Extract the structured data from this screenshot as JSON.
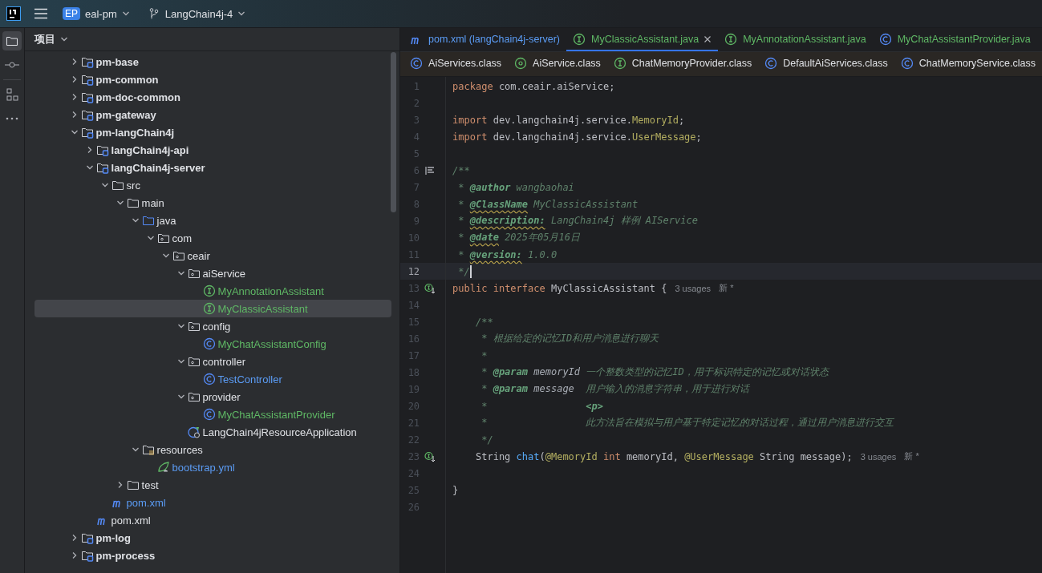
{
  "toolbar": {
    "project": {
      "badge": "EP",
      "name": "eal-pm"
    },
    "branch": "LangChain4j-4"
  },
  "project_panel": {
    "title": "项目",
    "tree": [
      {
        "name": "pm-base",
        "kind": "module",
        "color": "#dfe1e5",
        "expanded": false,
        "selected": false
      },
      {
        "name": "pm-common",
        "kind": "module",
        "color": "#dfe1e5",
        "expanded": false,
        "selected": false
      },
      {
        "name": "pm-doc-common",
        "kind": "module",
        "color": "#dfe1e5",
        "expanded": false,
        "selected": false
      },
      {
        "name": "pm-gateway",
        "kind": "module",
        "color": "#dfe1e5",
        "expanded": false,
        "selected": false
      },
      {
        "name": "pm-langChain4j",
        "kind": "module",
        "color": "#dfe1e5",
        "expanded": true,
        "selected": false,
        "children": [
          {
            "name": "langChain4j-api",
            "kind": "module",
            "color": "#dfe1e5",
            "expanded": false,
            "selected": false
          },
          {
            "name": "langChain4j-server",
            "kind": "module",
            "color": "#dfe1e5",
            "expanded": true,
            "selected": false,
            "children": [
              {
                "name": "src",
                "kind": "folder",
                "color": "#dfe1e5",
                "expanded": true,
                "selected": false,
                "children": [
                  {
                    "name": "main",
                    "kind": "folder",
                    "color": "#dfe1e5",
                    "expanded": true,
                    "selected": false,
                    "children": [
                      {
                        "name": "java",
                        "kind": "source-folder",
                        "color": "#dfe1e5",
                        "expanded": true,
                        "selected": false,
                        "children": [
                          {
                            "name": "com",
                            "kind": "package",
                            "color": "#dfe1e5",
                            "expanded": true,
                            "selected": false,
                            "children": [
                              {
                                "name": "ceair",
                                "kind": "package",
                                "color": "#dfe1e5",
                                "expanded": true,
                                "selected": false,
                                "children": [
                                  {
                                    "name": "aiService",
                                    "kind": "package",
                                    "color": "#dfe1e5",
                                    "expanded": true,
                                    "selected": false,
                                    "children": [
                                      {
                                        "name": "MyAnnotationAssistant",
                                        "kind": "interface",
                                        "color": "#5fb865",
                                        "selected": false
                                      },
                                      {
                                        "name": "MyClassicAssistant",
                                        "kind": "interface",
                                        "color": "#5fb865",
                                        "selected": true
                                      }
                                    ]
                                  },
                                  {
                                    "name": "config",
                                    "kind": "package",
                                    "color": "#dfe1e5",
                                    "expanded": true,
                                    "selected": false,
                                    "children": [
                                      {
                                        "name": "MyChatAssistantConfig",
                                        "kind": "class",
                                        "color": "#5fb865",
                                        "selected": false
                                      }
                                    ]
                                  },
                                  {
                                    "name": "controller",
                                    "kind": "package",
                                    "color": "#dfe1e5",
                                    "expanded": true,
                                    "selected": false,
                                    "children": [
                                      {
                                        "name": "TestController",
                                        "kind": "class",
                                        "color": "#5b9cf5",
                                        "selected": false
                                      }
                                    ]
                                  },
                                  {
                                    "name": "provider",
                                    "kind": "package",
                                    "color": "#dfe1e5",
                                    "expanded": true,
                                    "selected": false,
                                    "children": [
                                      {
                                        "name": "MyChatAssistantProvider",
                                        "kind": "class",
                                        "color": "#5fb865",
                                        "selected": false
                                      }
                                    ]
                                  },
                                  {
                                    "name": "LangChain4jResourceApplication",
                                    "kind": "app",
                                    "color": "#dfe1e5",
                                    "selected": false
                                  }
                                ]
                              }
                            ]
                          }
                        ]
                      },
                      {
                        "name": "resources",
                        "kind": "resource-folder",
                        "color": "#dfe1e5",
                        "expanded": true,
                        "selected": false,
                        "children": [
                          {
                            "name": "bootstrap.yml",
                            "kind": "yml",
                            "color": "#5b9cf5",
                            "selected": false
                          }
                        ]
                      }
                    ]
                  },
                  {
                    "name": "test",
                    "kind": "folder",
                    "color": "#dfe1e5",
                    "expanded": false,
                    "selected": false
                  }
                ]
              },
              {
                "name": "pom.xml",
                "kind": "maven",
                "color": "#5b9cf5",
                "selected": false
              }
            ]
          },
          {
            "name": "pom.xml",
            "kind": "maven",
            "color": "#dfe1e5",
            "selected": false
          }
        ]
      },
      {
        "name": "pm-log",
        "kind": "module",
        "color": "#dfe1e5",
        "expanded": false,
        "selected": false
      },
      {
        "name": "pm-process",
        "kind": "module",
        "color": "#dfe1e5",
        "expanded": false,
        "selected": false
      }
    ]
  },
  "editor_tabs": [
    {
      "label": "pom.xml (langChain4j-server)",
      "kind": "maven",
      "color": "#5b9cf5",
      "selected": false
    },
    {
      "label": "MyClassicAssistant.java",
      "kind": "interface",
      "color": "#5fb865",
      "selected": true
    },
    {
      "label": "MyAnnotationAssistant.java",
      "kind": "interface",
      "color": "#5fb865",
      "selected": false
    },
    {
      "label": "MyChatAssistantProvider.java",
      "kind": "class",
      "color": "#5fb865",
      "selected": false
    }
  ],
  "editor_tabs_row2": [
    {
      "label": "AiServices.class",
      "kind": "class",
      "selected": false
    },
    {
      "label": "AiService.class",
      "kind": "annotation",
      "selected": false
    },
    {
      "label": "ChatMemoryProvider.class",
      "kind": "interface",
      "selected": false
    },
    {
      "label": "DefaultAiServices.class",
      "kind": "class",
      "selected": false
    },
    {
      "label": "ChatMemoryService.class",
      "kind": "class",
      "selected": false
    }
  ],
  "code_lines": [
    {
      "number": "1",
      "current": false,
      "tokens": [
        {
          "kind": "keyword",
          "text": "package"
        },
        {
          "kind": "plain",
          "text": " com.ceair.aiService;"
        }
      ]
    },
    {
      "number": "2",
      "current": false
    },
    {
      "number": "3",
      "current": false,
      "tokens": [
        {
          "kind": "keyword",
          "text": "import"
        },
        {
          "kind": "plain",
          "text": " dev.langchain4j.service."
        },
        {
          "kind": "annotation",
          "text": "MemoryId"
        },
        {
          "kind": "plain",
          "text": ";"
        }
      ]
    },
    {
      "number": "4",
      "current": false,
      "tokens": [
        {
          "kind": "keyword",
          "text": "import"
        },
        {
          "kind": "plain",
          "text": " dev.langchain4j.service."
        },
        {
          "kind": "annotation",
          "text": "UserMessage"
        },
        {
          "kind": "plain",
          "text": ";"
        }
      ]
    },
    {
      "number": "5",
      "current": false
    },
    {
      "number": "6",
      "current": false,
      "doc_marker": true,
      "tokens": [
        {
          "kind": "comment",
          "text": "/**"
        }
      ]
    },
    {
      "number": "7",
      "current": false,
      "tokens": [
        {
          "kind": "comment",
          "text": " * "
        },
        {
          "kind": "doctag",
          "text": "@author"
        },
        {
          "kind": "comment",
          "text": " wangbaohai"
        }
      ]
    },
    {
      "number": "8",
      "current": false,
      "tokens": [
        {
          "kind": "comment",
          "text": " * "
        },
        {
          "kind": "doctag",
          "text": "@ClassName",
          "warning": true
        },
        {
          "kind": "comment",
          "text": " MyClassicAssistant"
        }
      ]
    },
    {
      "number": "9",
      "current": false,
      "tokens": [
        {
          "kind": "comment",
          "text": " * "
        },
        {
          "kind": "doctag",
          "text": "@description:",
          "warning": true
        },
        {
          "kind": "comment",
          "text": " LangChain4j 样例 AIService"
        }
      ]
    },
    {
      "number": "10",
      "current": false,
      "tokens": [
        {
          "kind": "comment",
          "text": " * "
        },
        {
          "kind": "doctag",
          "text": "@date",
          "warning": true
        },
        {
          "kind": "comment",
          "text": " 2025年05月16日"
        }
      ]
    },
    {
      "number": "11",
      "current": false,
      "tokens": [
        {
          "kind": "comment",
          "text": " * "
        },
        {
          "kind": "doctag",
          "text": "@version:",
          "warning": true
        },
        {
          "kind": "comment",
          "text": " 1.0.0"
        }
      ]
    },
    {
      "number": "12",
      "current": true,
      "tokens": [
        {
          "kind": "comment",
          "text": " */"
        }
      ]
    },
    {
      "number": "13",
      "current": false,
      "implemented_marker": true,
      "tokens": [
        {
          "kind": "keyword",
          "text": "public"
        },
        {
          "kind": "keyword",
          "text": " interface"
        },
        {
          "kind": "plain",
          "text": " MyClassicAssistant {"
        }
      ],
      "hints": [
        "3 usages",
        "新 *"
      ]
    },
    {
      "number": "14",
      "current": false
    },
    {
      "number": "15",
      "current": false,
      "tokens": [
        {
          "kind": "comment",
          "text": "    /**"
        }
      ]
    },
    {
      "number": "16",
      "current": false,
      "tokens": [
        {
          "kind": "comment",
          "text": "     * 根据给定的记忆ID和用户消息进行聊天"
        }
      ]
    },
    {
      "number": "17",
      "current": false,
      "tokens": [
        {
          "kind": "comment",
          "text": "     *"
        }
      ]
    },
    {
      "number": "18",
      "current": false,
      "tokens": [
        {
          "kind": "comment",
          "text": "     * "
        },
        {
          "kind": "doctag",
          "text": "@param"
        },
        {
          "kind": "param",
          "text": " memoryId"
        },
        {
          "kind": "comment",
          "text": " 一个整数类型的记忆ID，用于标识特定的记忆或对话状态"
        }
      ]
    },
    {
      "number": "19",
      "current": false,
      "tokens": [
        {
          "kind": "comment",
          "text": "     * "
        },
        {
          "kind": "doctag",
          "text": "@param"
        },
        {
          "kind": "param",
          "text": " message"
        },
        {
          "kind": "comment",
          "text": "  用户输入的消息字符串，用于进行对话"
        }
      ]
    },
    {
      "number": "20",
      "current": false,
      "tokens": [
        {
          "kind": "comment",
          "text": "     *                 "
        },
        {
          "kind": "doctag",
          "text": "<p>"
        }
      ]
    },
    {
      "number": "21",
      "current": false,
      "tokens": [
        {
          "kind": "comment",
          "text": "     *                 此方法旨在模拟与用户基于特定记忆的对话过程，通过用户消息进行交互"
        }
      ]
    },
    {
      "number": "22",
      "current": false,
      "tokens": [
        {
          "kind": "comment",
          "text": "     */"
        }
      ]
    },
    {
      "number": "23",
      "current": false,
      "implemented_marker": true,
      "tokens": [
        {
          "kind": "plain",
          "text": "    String "
        },
        {
          "kind": "method",
          "text": "chat"
        },
        {
          "kind": "plain",
          "text": "("
        },
        {
          "kind": "annotation",
          "text": "@MemoryId"
        },
        {
          "kind": "keyword",
          "text": " int"
        },
        {
          "kind": "plain",
          "text": " memoryId, "
        },
        {
          "kind": "annotation",
          "text": "@UserMessage"
        },
        {
          "kind": "plain",
          "text": " String message);"
        }
      ],
      "hints": [
        "3 usages",
        "新 *"
      ]
    },
    {
      "number": "24",
      "current": false
    },
    {
      "number": "25",
      "current": false,
      "tokens": [
        {
          "kind": "plain",
          "text": "}"
        }
      ]
    },
    {
      "number": "26",
      "current": false
    }
  ]
}
